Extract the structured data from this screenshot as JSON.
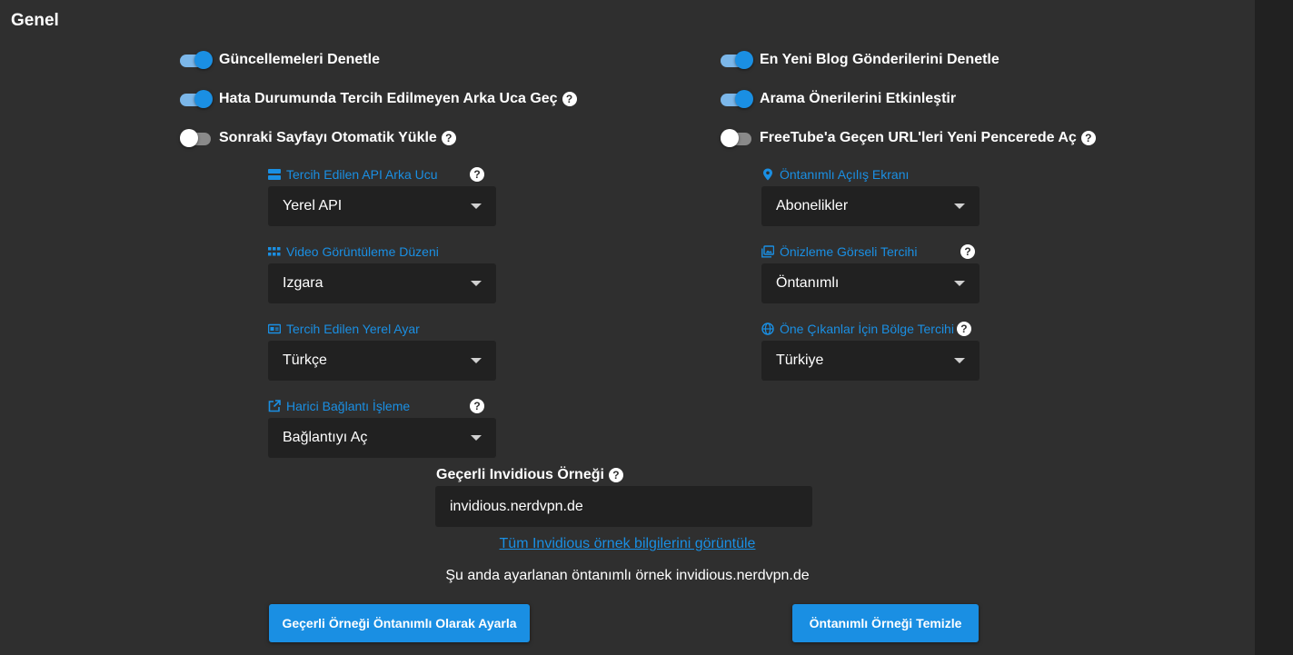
{
  "section": {
    "title": "Genel"
  },
  "switches": {
    "check_updates": {
      "label": "Güncellemeleri Denetle",
      "on": true
    },
    "fallback": {
      "label": "Hata Durumunda Tercih Edilmeyen Arka Uca Geç",
      "on": true
    },
    "autoload": {
      "label": "Sonraki Sayfayı Otomatik Yükle",
      "on": false
    },
    "blog_posts": {
      "label": "En Yeni Blog Gönderilerini Denetle",
      "on": true
    },
    "search_suggestions": {
      "label": "Arama Önerilerini Etkinleştir",
      "on": true
    },
    "open_urls": {
      "label": "FreeTube'a Geçen URL'leri Yeni Pencerede Aç",
      "on": false
    }
  },
  "selects": {
    "api_backend": {
      "label": "Tercih Edilen API Arka Ucu",
      "value": "Yerel API",
      "icon": "server-icon"
    },
    "view_layout": {
      "label": "Video Görüntüleme Düzeni",
      "value": "Izgara",
      "icon": "grid-icon"
    },
    "locale": {
      "label": "Tercih Edilen Yerel Ayar",
      "value": "Türkçe",
      "icon": "language-icon"
    },
    "external_link": {
      "label": "Harici Bağlantı İşleme",
      "value": "Bağlantıyı Aç",
      "icon": "external-link-icon"
    },
    "landing_page": {
      "label": "Öntanımlı Açılış Ekranı",
      "value": "Abonelikler",
      "icon": "location-pin-icon"
    },
    "thumbnail": {
      "label": "Önizleme Görseli Tercihi",
      "value": "Öntanımlı",
      "icon": "image-icon"
    },
    "region": {
      "label": "Öne Çıkanlar İçin Bölge Tercihi",
      "value": "Türkiye",
      "icon": "globe-icon"
    }
  },
  "help_glyph": "?",
  "instance": {
    "label": "Geçerli Invidious Örneği",
    "value": "invidious.nerdvpn.de",
    "view_all_link": "Tüm Invidious örnek bilgilerini görüntüle",
    "current_text": "Şu anda ayarlanan öntanımlı örnek invidious.nerdvpn.de"
  },
  "buttons": {
    "set_default": "Geçerli Örneği Öntanımlı Olarak Ayarla",
    "clear_default": "Öntanımlı Örneği Temizle"
  },
  "colors": {
    "accent": "#1a8fe3",
    "background": "#2f2f2f",
    "field": "#212121"
  }
}
